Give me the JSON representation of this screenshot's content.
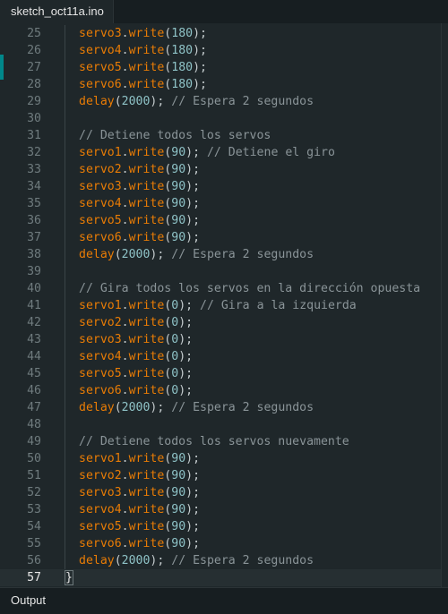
{
  "tab": {
    "filename": "sketch_oct11a.ino"
  },
  "bottom_panel": {
    "label": "Output"
  },
  "editor": {
    "current_line": "57",
    "lines": [
      {
        "n": "25",
        "obj": "servo3",
        "fn": "write",
        "arg": "180",
        "comment": ""
      },
      {
        "n": "26",
        "obj": "servo4",
        "fn": "write",
        "arg": "180",
        "comment": ""
      },
      {
        "n": "27",
        "obj": "servo5",
        "fn": "write",
        "arg": "180",
        "comment": ""
      },
      {
        "n": "28",
        "obj": "servo6",
        "fn": "write",
        "arg": "180",
        "comment": ""
      },
      {
        "n": "29",
        "obj": "",
        "fn": "delay",
        "arg": "2000",
        "comment": "// Espera 2 segundos"
      },
      {
        "n": "30",
        "blank": true
      },
      {
        "n": "31",
        "comment_only": "// Detiene todos los servos"
      },
      {
        "n": "32",
        "obj": "servo1",
        "fn": "write",
        "arg": "90",
        "comment": "// Detiene el giro"
      },
      {
        "n": "33",
        "obj": "servo2",
        "fn": "write",
        "arg": "90",
        "comment": ""
      },
      {
        "n": "34",
        "obj": "servo3",
        "fn": "write",
        "arg": "90",
        "comment": ""
      },
      {
        "n": "35",
        "obj": "servo4",
        "fn": "write",
        "arg": "90",
        "comment": ""
      },
      {
        "n": "36",
        "obj": "servo5",
        "fn": "write",
        "arg": "90",
        "comment": ""
      },
      {
        "n": "37",
        "obj": "servo6",
        "fn": "write",
        "arg": "90",
        "comment": ""
      },
      {
        "n": "38",
        "obj": "",
        "fn": "delay",
        "arg": "2000",
        "comment": "// Espera 2 segundos"
      },
      {
        "n": "39",
        "blank": true
      },
      {
        "n": "40",
        "comment_only": "// Gira todos los servos en la dirección opuesta"
      },
      {
        "n": "41",
        "obj": "servo1",
        "fn": "write",
        "arg": "0",
        "comment": "// Gira a la izquierda"
      },
      {
        "n": "42",
        "obj": "servo2",
        "fn": "write",
        "arg": "0",
        "comment": ""
      },
      {
        "n": "43",
        "obj": "servo3",
        "fn": "write",
        "arg": "0",
        "comment": ""
      },
      {
        "n": "44",
        "obj": "servo4",
        "fn": "write",
        "arg": "0",
        "comment": ""
      },
      {
        "n": "45",
        "obj": "servo5",
        "fn": "write",
        "arg": "0",
        "comment": ""
      },
      {
        "n": "46",
        "obj": "servo6",
        "fn": "write",
        "arg": "0",
        "comment": ""
      },
      {
        "n": "47",
        "obj": "",
        "fn": "delay",
        "arg": "2000",
        "comment": "// Espera 2 segundos"
      },
      {
        "n": "48",
        "blank": true
      },
      {
        "n": "49",
        "comment_only": "// Detiene todos los servos nuevamente"
      },
      {
        "n": "50",
        "obj": "servo1",
        "fn": "write",
        "arg": "90",
        "comment": ""
      },
      {
        "n": "51",
        "obj": "servo2",
        "fn": "write",
        "arg": "90",
        "comment": ""
      },
      {
        "n": "52",
        "obj": "servo3",
        "fn": "write",
        "arg": "90",
        "comment": ""
      },
      {
        "n": "53",
        "obj": "servo4",
        "fn": "write",
        "arg": "90",
        "comment": ""
      },
      {
        "n": "54",
        "obj": "servo5",
        "fn": "write",
        "arg": "90",
        "comment": ""
      },
      {
        "n": "55",
        "obj": "servo6",
        "fn": "write",
        "arg": "90",
        "comment": ""
      },
      {
        "n": "56",
        "obj": "",
        "fn": "delay",
        "arg": "2000",
        "comment": "// Espera 2 segundos"
      },
      {
        "n": "57",
        "brace": "}"
      }
    ]
  },
  "colors": {
    "background": "#1f272a",
    "identifier": "#e97c05",
    "number": "#8fc3c7",
    "comment": "#8a9498",
    "line_number": "#6f7b7e",
    "accent": "#00878a"
  }
}
